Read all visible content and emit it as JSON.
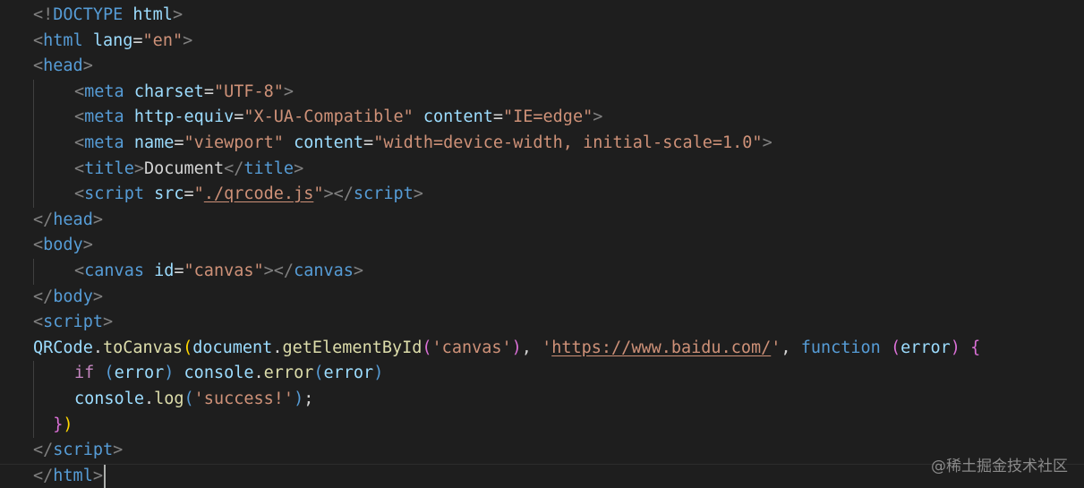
{
  "editor": {
    "language": "html",
    "cursor_line": 19
  },
  "code_lines": [
    {
      "indent": 0,
      "tokens": [
        {
          "t": "<!",
          "c": "punct"
        },
        {
          "t": "DOCTYPE",
          "c": "tag"
        },
        {
          "t": " ",
          "c": "text"
        },
        {
          "t": "html",
          "c": "attr"
        },
        {
          "t": ">",
          "c": "punct"
        }
      ]
    },
    {
      "indent": 0,
      "tokens": [
        {
          "t": "<",
          "c": "punct"
        },
        {
          "t": "html",
          "c": "tag"
        },
        {
          "t": " ",
          "c": "text"
        },
        {
          "t": "lang",
          "c": "attr"
        },
        {
          "t": "=",
          "c": "text"
        },
        {
          "t": "\"en\"",
          "c": "str"
        },
        {
          "t": ">",
          "c": "punct"
        }
      ]
    },
    {
      "indent": 0,
      "tokens": [
        {
          "t": "<",
          "c": "punct"
        },
        {
          "t": "head",
          "c": "tag"
        },
        {
          "t": ">",
          "c": "punct"
        }
      ]
    },
    {
      "indent": 1,
      "tokens": [
        {
          "t": "<",
          "c": "punct"
        },
        {
          "t": "meta",
          "c": "tag"
        },
        {
          "t": " ",
          "c": "text"
        },
        {
          "t": "charset",
          "c": "attr"
        },
        {
          "t": "=",
          "c": "text"
        },
        {
          "t": "\"UTF-8\"",
          "c": "str"
        },
        {
          "t": ">",
          "c": "punct"
        }
      ]
    },
    {
      "indent": 1,
      "tokens": [
        {
          "t": "<",
          "c": "punct"
        },
        {
          "t": "meta",
          "c": "tag"
        },
        {
          "t": " ",
          "c": "text"
        },
        {
          "t": "http-equiv",
          "c": "attr"
        },
        {
          "t": "=",
          "c": "text"
        },
        {
          "t": "\"X-UA-Compatible\"",
          "c": "str"
        },
        {
          "t": " ",
          "c": "text"
        },
        {
          "t": "content",
          "c": "attr"
        },
        {
          "t": "=",
          "c": "text"
        },
        {
          "t": "\"IE=edge\"",
          "c": "str"
        },
        {
          "t": ">",
          "c": "punct"
        }
      ]
    },
    {
      "indent": 1,
      "tokens": [
        {
          "t": "<",
          "c": "punct"
        },
        {
          "t": "meta",
          "c": "tag"
        },
        {
          "t": " ",
          "c": "text"
        },
        {
          "t": "name",
          "c": "attr"
        },
        {
          "t": "=",
          "c": "text"
        },
        {
          "t": "\"viewport\"",
          "c": "str"
        },
        {
          "t": " ",
          "c": "text"
        },
        {
          "t": "content",
          "c": "attr"
        },
        {
          "t": "=",
          "c": "text"
        },
        {
          "t": "\"width=device-width, initial-scale=1.0\"",
          "c": "str"
        },
        {
          "t": ">",
          "c": "punct"
        }
      ]
    },
    {
      "indent": 1,
      "tokens": [
        {
          "t": "<",
          "c": "punct"
        },
        {
          "t": "title",
          "c": "tag"
        },
        {
          "t": ">",
          "c": "punct"
        },
        {
          "t": "Document",
          "c": "text"
        },
        {
          "t": "</",
          "c": "punct"
        },
        {
          "t": "title",
          "c": "tag"
        },
        {
          "t": ">",
          "c": "punct"
        }
      ]
    },
    {
      "indent": 1,
      "tokens": [
        {
          "t": "<",
          "c": "punct"
        },
        {
          "t": "script",
          "c": "tag"
        },
        {
          "t": " ",
          "c": "text"
        },
        {
          "t": "src",
          "c": "attr"
        },
        {
          "t": "=",
          "c": "text"
        },
        {
          "t": "\"",
          "c": "str"
        },
        {
          "t": "./qrcode.js",
          "c": "str",
          "link": true
        },
        {
          "t": "\"",
          "c": "str"
        },
        {
          "t": "></",
          "c": "punct"
        },
        {
          "t": "script",
          "c": "tag"
        },
        {
          "t": ">",
          "c": "punct"
        }
      ]
    },
    {
      "indent": 0,
      "tokens": [
        {
          "t": "</",
          "c": "punct"
        },
        {
          "t": "head",
          "c": "tag"
        },
        {
          "t": ">",
          "c": "punct"
        }
      ]
    },
    {
      "indent": 0,
      "tokens": [
        {
          "t": "<",
          "c": "punct"
        },
        {
          "t": "body",
          "c": "tag"
        },
        {
          "t": ">",
          "c": "punct"
        }
      ]
    },
    {
      "indent": 1,
      "tokens": [
        {
          "t": "<",
          "c": "punct"
        },
        {
          "t": "canvas",
          "c": "tag"
        },
        {
          "t": " ",
          "c": "text"
        },
        {
          "t": "id",
          "c": "attr"
        },
        {
          "t": "=",
          "c": "text"
        },
        {
          "t": "\"canvas\"",
          "c": "str"
        },
        {
          "t": "></",
          "c": "punct"
        },
        {
          "t": "canvas",
          "c": "tag"
        },
        {
          "t": ">",
          "c": "punct"
        }
      ]
    },
    {
      "indent": 0,
      "tokens": [
        {
          "t": "</",
          "c": "punct"
        },
        {
          "t": "body",
          "c": "tag"
        },
        {
          "t": ">",
          "c": "punct"
        }
      ]
    },
    {
      "indent": 0,
      "tokens": [
        {
          "t": "<",
          "c": "punct"
        },
        {
          "t": "script",
          "c": "tag"
        },
        {
          "t": ">",
          "c": "punct"
        }
      ]
    },
    {
      "indent": 0,
      "tokens": [
        {
          "t": "QRCode",
          "c": "ident"
        },
        {
          "t": ".",
          "c": "text"
        },
        {
          "t": "toCanvas",
          "c": "fn"
        },
        {
          "t": "(",
          "c": "brace1"
        },
        {
          "t": "document",
          "c": "ident"
        },
        {
          "t": ".",
          "c": "text"
        },
        {
          "t": "getElementById",
          "c": "fn"
        },
        {
          "t": "(",
          "c": "brace2"
        },
        {
          "t": "'canvas'",
          "c": "str"
        },
        {
          "t": ")",
          "c": "brace2"
        },
        {
          "t": ", ",
          "c": "text"
        },
        {
          "t": "'",
          "c": "str"
        },
        {
          "t": "https://www.baidu.com/",
          "c": "str",
          "link": true
        },
        {
          "t": "'",
          "c": "str"
        },
        {
          "t": ", ",
          "c": "text"
        },
        {
          "t": "function",
          "c": "kw"
        },
        {
          "t": " ",
          "c": "text"
        },
        {
          "t": "(",
          "c": "brace2"
        },
        {
          "t": "error",
          "c": "ident"
        },
        {
          "t": ")",
          "c": "brace2"
        },
        {
          "t": " ",
          "c": "text"
        },
        {
          "t": "{",
          "c": "brace2"
        }
      ]
    },
    {
      "indent": 1,
      "tokens": [
        {
          "t": "if",
          "c": "ctrl"
        },
        {
          "t": " ",
          "c": "text"
        },
        {
          "t": "(",
          "c": "kw"
        },
        {
          "t": "error",
          "c": "ident"
        },
        {
          "t": ")",
          "c": "kw"
        },
        {
          "t": " ",
          "c": "text"
        },
        {
          "t": "console",
          "c": "ident"
        },
        {
          "t": ".",
          "c": "text"
        },
        {
          "t": "error",
          "c": "fn"
        },
        {
          "t": "(",
          "c": "kw"
        },
        {
          "t": "error",
          "c": "ident"
        },
        {
          "t": ")",
          "c": "kw"
        }
      ]
    },
    {
      "indent": 1,
      "tokens": [
        {
          "t": "console",
          "c": "ident"
        },
        {
          "t": ".",
          "c": "text"
        },
        {
          "t": "log",
          "c": "fn"
        },
        {
          "t": "(",
          "c": "kw"
        },
        {
          "t": "'success!'",
          "c": "str"
        },
        {
          "t": ")",
          "c": "kw"
        },
        {
          "t": ";",
          "c": "text"
        }
      ]
    },
    {
      "indent": 0,
      "lead": "  ",
      "tokens": [
        {
          "t": "}",
          "c": "brace2"
        },
        {
          "t": ")",
          "c": "brace1"
        }
      ]
    },
    {
      "indent": 0,
      "tokens": [
        {
          "t": "</",
          "c": "punct"
        },
        {
          "t": "script",
          "c": "tag"
        },
        {
          "t": ">",
          "c": "punct"
        }
      ]
    },
    {
      "indent": 0,
      "tokens": [
        {
          "t": "</",
          "c": "punct"
        },
        {
          "t": "html",
          "c": "tag"
        },
        {
          "t": ">",
          "c": "punct"
        }
      ]
    }
  ],
  "watermark": {
    "text": "@稀土掘金技术社区"
  }
}
